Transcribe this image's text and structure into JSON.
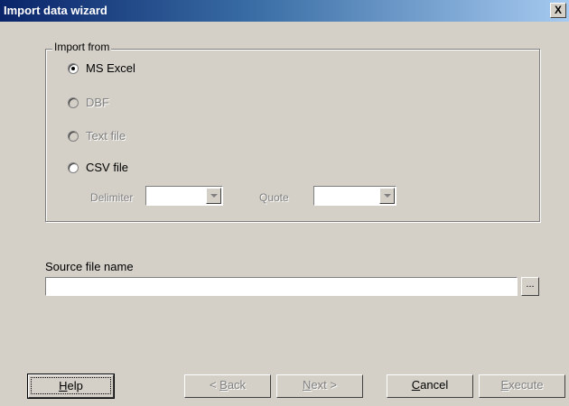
{
  "window": {
    "title": "Import data wizard",
    "close_label": "X"
  },
  "import_from": {
    "legend": "Import from",
    "options": [
      {
        "label": "MS Excel",
        "selected": true,
        "enabled": true
      },
      {
        "label": "DBF",
        "selected": false,
        "enabled": false
      },
      {
        "label": "Text file",
        "selected": false,
        "enabled": false
      },
      {
        "label": "CSV file",
        "selected": false,
        "enabled": true
      }
    ],
    "delimiter_label": "Delimiter",
    "delimiter_value": "",
    "quote_label": "Quote",
    "quote_value": ""
  },
  "source_file": {
    "label": "Source file name",
    "value": "",
    "browse_label": "..."
  },
  "buttons": {
    "help": {
      "label": "Help",
      "key": "H",
      "rest": "elp"
    },
    "back": {
      "label": "< Back",
      "pre": "< ",
      "key": "B",
      "rest": "ack"
    },
    "next": {
      "label": "Next >",
      "key": "N",
      "rest": "ext >"
    },
    "cancel": {
      "label": "Cancel",
      "key": "C",
      "rest": "ancel"
    },
    "execute": {
      "label": "Execute",
      "key": "E",
      "rest": "xecute"
    }
  }
}
